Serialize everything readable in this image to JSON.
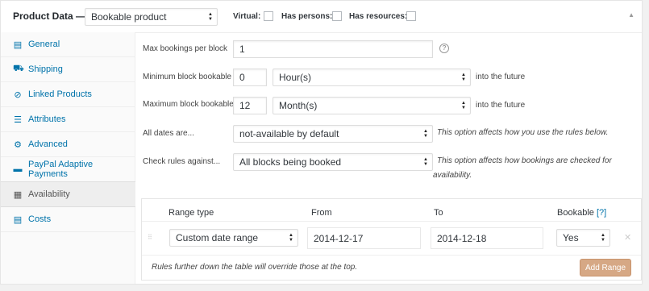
{
  "header": {
    "title": "Product Data —",
    "product_type": "Bookable product",
    "virtual_label": "Virtual:",
    "has_persons_label": "Has persons:",
    "has_resources_label": "Has resources:"
  },
  "tabs": [
    {
      "label": "General",
      "icon": "general-icon"
    },
    {
      "label": "Shipping",
      "icon": "truck-icon"
    },
    {
      "label": "Linked Products",
      "icon": "link-icon"
    },
    {
      "label": "Attributes",
      "icon": "list-icon"
    },
    {
      "label": "Advanced",
      "icon": "gear-icon"
    },
    {
      "label": "PayPal Adaptive Payments",
      "icon": "paypal-icon"
    },
    {
      "label": "Availability",
      "icon": "calendar-icon",
      "active": true
    },
    {
      "label": "Costs",
      "icon": "costs-icon"
    }
  ],
  "fields": {
    "max_bookings": {
      "label": "Max bookings per block",
      "value": "1"
    },
    "min_block": {
      "label": "Minimum block bookable",
      "value": "0",
      "unit": "Hour(s)",
      "suffix": "into the future"
    },
    "max_block": {
      "label": "Maximum block bookable",
      "value": "12",
      "unit": "Month(s)",
      "suffix": "into the future"
    },
    "all_dates": {
      "label": "All dates are...",
      "value": "not-available by default",
      "desc": "This option affects how you use the rules below."
    },
    "check_rules": {
      "label": "Check rules against...",
      "value": "All blocks being booked",
      "desc_line1": "This option affects how bookings are checked for",
      "desc_line2": "availability."
    }
  },
  "table": {
    "headers": {
      "range_type": "Range type",
      "from": "From",
      "to": "To",
      "bookable": "Bookable",
      "help": "[?]"
    },
    "rows": [
      {
        "range_type": "Custom date range",
        "from": "2014-12-17",
        "to": "2014-12-18",
        "bookable": "Yes"
      }
    ],
    "footer_note": "Rules further down the table will override those at the top.",
    "add_button": "Add Range"
  },
  "colors": {
    "link": "#0073aa",
    "button": "#d6a885"
  }
}
